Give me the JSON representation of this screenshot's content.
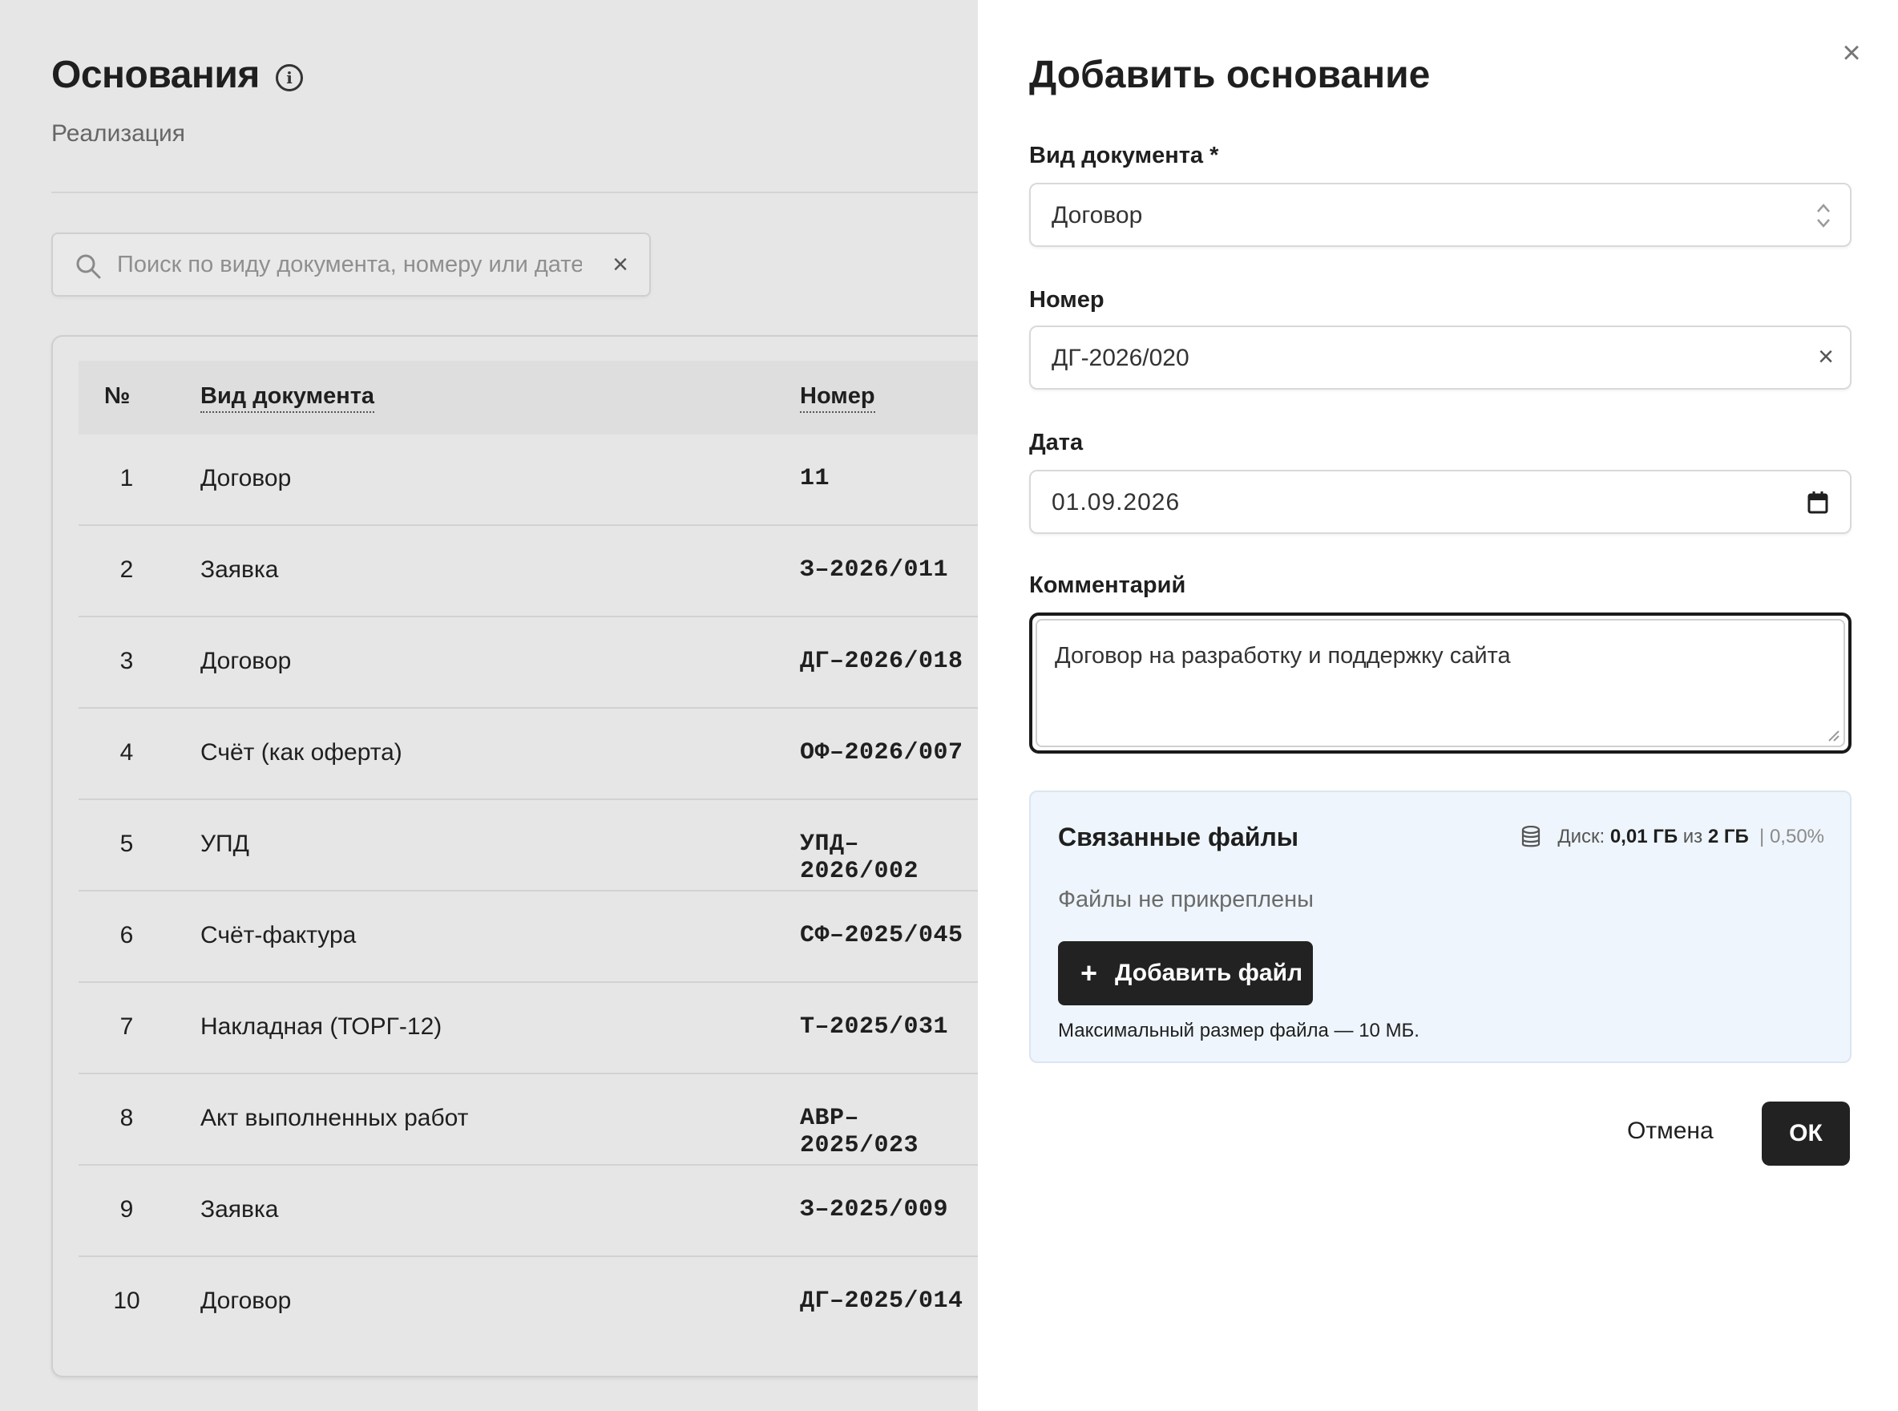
{
  "list": {
    "title": "Основания",
    "subtitle": "Реализация",
    "search": {
      "placeholder": "Поиск по виду документа, номеру или дате",
      "value": ""
    },
    "columns": {
      "n": "№",
      "doc": "Вид документа",
      "num": "Номер"
    },
    "rows": [
      {
        "n": "1",
        "doc": "Договор",
        "num": "11"
      },
      {
        "n": "2",
        "doc": "Заявка",
        "num": "З–2026/011"
      },
      {
        "n": "3",
        "doc": "Договор",
        "num": "ДГ–2026/018"
      },
      {
        "n": "4",
        "doc": "Счёт (как оферта)",
        "num": "ОФ–2026/007"
      },
      {
        "n": "5",
        "doc": "УПД",
        "num": "УПД–2026/002"
      },
      {
        "n": "6",
        "doc": "Счёт-фактура",
        "num": "СФ–2025/045"
      },
      {
        "n": "7",
        "doc": "Накладная (ТОРГ-12)",
        "num": "Т–2025/031"
      },
      {
        "n": "8",
        "doc": "Акт выполненных работ",
        "num": "АВР–2025/023"
      },
      {
        "n": "9",
        "doc": "Заявка",
        "num": "З–2025/009"
      },
      {
        "n": "10",
        "doc": "Договор",
        "num": "ДГ–2025/014"
      }
    ]
  },
  "dialog": {
    "title": "Добавить основание",
    "doc_type": {
      "label": "Вид документа *",
      "value": "Договор"
    },
    "number": {
      "label": "Номер",
      "value": "ДГ-2026/020"
    },
    "date": {
      "label": "Дата",
      "value": "01.09.2026"
    },
    "comment": {
      "label": "Комментарий",
      "value": "Договор на разработку и поддержку сайта"
    },
    "files": {
      "title": "Связанные файлы",
      "disk_label": "Диск:",
      "disk_used": "0,01 ГБ",
      "disk_of": "из",
      "disk_total": "2 ГБ",
      "disk_pct": "| 0,50%",
      "empty": "Файлы не прикреплены",
      "add_label": "Добавить файл",
      "hint": "Максимальный размер файла — 10 МБ."
    },
    "cancel_label": "Отмена",
    "ok_label": "ОК"
  },
  "icons": {
    "info": "info-icon",
    "search": "search-icon",
    "clear": "close-icon",
    "close": "close-icon",
    "select": "chevron-up-down-icon",
    "calendar": "calendar-icon",
    "disk": "database-icon",
    "plus": "plus-icon"
  }
}
